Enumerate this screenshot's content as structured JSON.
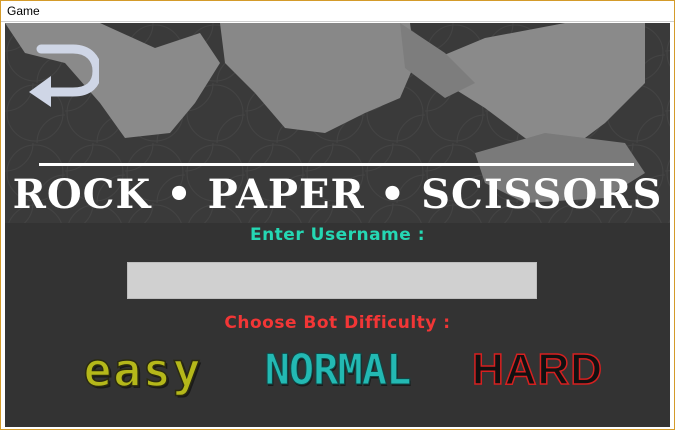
{
  "window": {
    "title": "Game"
  },
  "header": {
    "title": "ROCK • PAPER • SCISSORS",
    "back_icon": "return-arrow-icon"
  },
  "form": {
    "username_label": "Enter Username :",
    "username_value": "",
    "difficulty_label": "Choose Bot Difficulty :"
  },
  "difficulty": {
    "easy": "easy",
    "normal": "NORMAL",
    "hard": "HARD"
  },
  "colors": {
    "background": "#333333",
    "username_label": "#25d7b3",
    "difficulty_label": "#f23636",
    "easy": "#b5b81a",
    "normal": "#23b9b3",
    "hard_outline": "#d62020"
  }
}
